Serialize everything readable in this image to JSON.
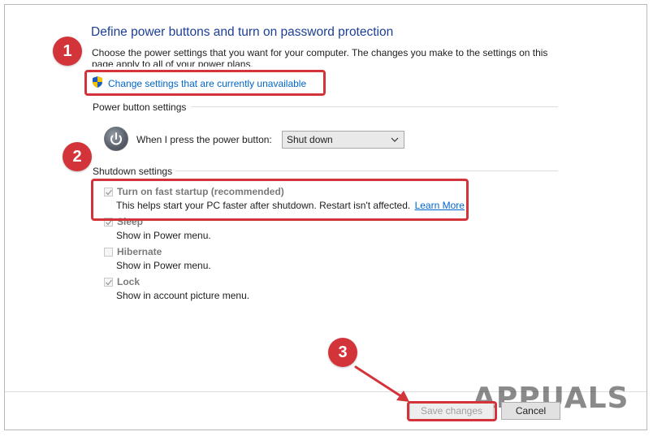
{
  "page": {
    "title": "Define power buttons and turn on password protection",
    "description": "Choose the power settings that you want for your computer. The changes you make to the settings on this page apply to all of your power plans.",
    "change_settings_link": "Change settings that are currently unavailable"
  },
  "power_button_settings": {
    "heading": "Power button settings",
    "label": "When I press the power button:",
    "selected": "Shut down"
  },
  "shutdown_settings": {
    "heading": "Shutdown settings",
    "options": [
      {
        "label": "Turn on fast startup (recommended)",
        "description": "This helps start your PC faster after shutdown. Restart isn't affected.",
        "link": "Learn More",
        "checked": true
      },
      {
        "label": "Sleep",
        "description": "Show in Power menu.",
        "checked": true
      },
      {
        "label": "Hibernate",
        "description": "Show in Power menu.",
        "checked": false
      },
      {
        "label": "Lock",
        "description": "Show in account picture menu.",
        "checked": true
      }
    ]
  },
  "buttons": {
    "save": "Save changes",
    "cancel": "Cancel"
  },
  "annotations": {
    "step1": "1",
    "step2": "2",
    "step3": "3",
    "highlight_color": "#d3343a"
  },
  "watermark": "APPUALS"
}
